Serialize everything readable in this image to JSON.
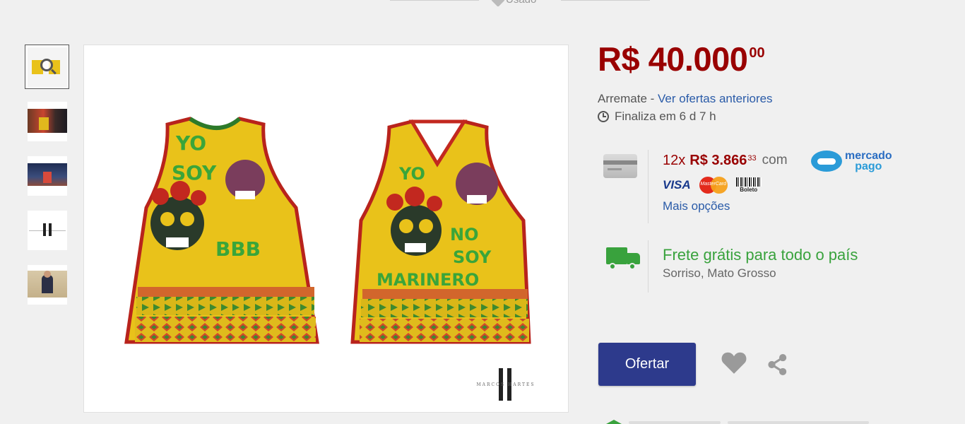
{
  "condition": {
    "label": "Usado",
    "icon": "tag-icon"
  },
  "gallery": {
    "thumbnails": [
      {
        "name": "thumbnail-1",
        "active": true
      },
      {
        "name": "thumbnail-2",
        "active": false
      },
      {
        "name": "thumbnail-3",
        "active": false
      },
      {
        "name": "thumbnail-4",
        "active": false
      },
      {
        "name": "thumbnail-5",
        "active": false
      }
    ],
    "main_image": {
      "jersey_left_text": [
        "YO",
        "SOY",
        "BBB"
      ],
      "jersey_right_text": [
        "YO",
        "NO",
        "SOY",
        "MARINERO"
      ],
      "watermark": "MARCOS HARTES"
    }
  },
  "product": {
    "price_main": "R$ 40.000",
    "price_cents": "00",
    "sale_type": "Arremate",
    "separator": " - ",
    "previous_offers_link": "Ver ofertas anteriores",
    "ends_in": "Finaliza em 6 d 7 h"
  },
  "payment": {
    "installments": "12x",
    "installment_amount": "R$ 3.866",
    "installment_cents": "33",
    "with_label": "com",
    "provider_line1": "mercado",
    "provider_line2": "pago",
    "methods": [
      "VISA",
      "MasterCard",
      "Boleto"
    ],
    "more_options": "Mais opções"
  },
  "shipping": {
    "title": "Frete grátis para todo o país",
    "location": "Sorriso, Mato Grosso"
  },
  "actions": {
    "offer_button": "Ofertar",
    "favorite_icon": "heart-icon",
    "share_icon": "share-icon"
  },
  "colors": {
    "price": "#990000",
    "link": "#2a5ba8",
    "primary_button": "#2d3a8c",
    "shipping_green": "#39a23d",
    "jersey_yellow": "#e9c21a"
  }
}
